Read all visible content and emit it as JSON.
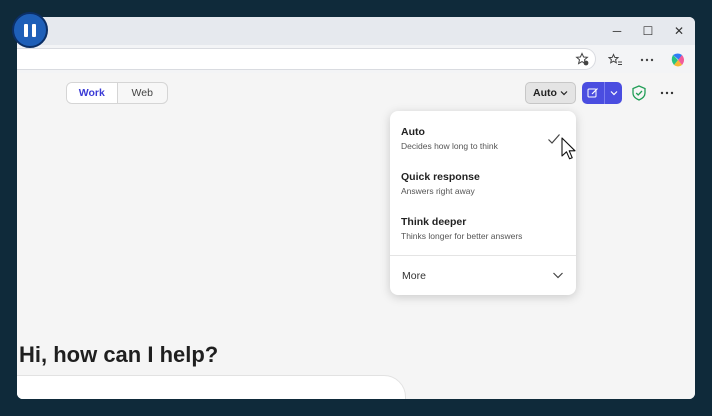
{
  "mode_toggle": {
    "work_label": "Work",
    "web_label": "Web"
  },
  "model_picker": {
    "selected_label": "Auto",
    "options": [
      {
        "title": "Auto",
        "description": "Decides how long to think",
        "selected": true
      },
      {
        "title": "Quick response",
        "description": "Answers right away",
        "selected": false
      },
      {
        "title": "Think deeper",
        "description": "Thinks longer for better answers",
        "selected": false
      }
    ],
    "more_label": "More"
  },
  "main": {
    "greeting": "Hi, how can I help?"
  },
  "window_controls": {
    "minimize": "─",
    "maximize": "☐",
    "close": "✕"
  },
  "icons": {
    "accent": "#4a4de0",
    "shield_color": "#1f9d55"
  }
}
